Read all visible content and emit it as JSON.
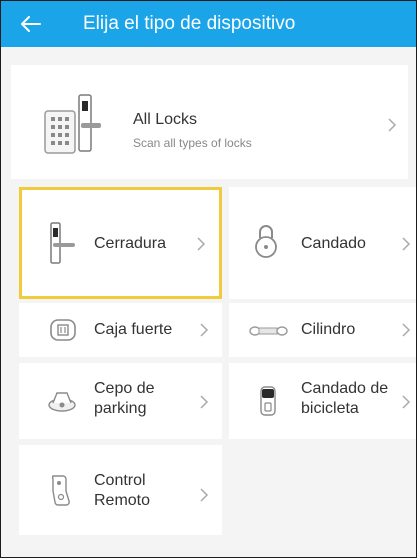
{
  "header": {
    "back_icon": "arrow-left-icon",
    "title": "Elija el tipo de dispositivo"
  },
  "all_locks": {
    "title": "All Locks",
    "subtitle": "Scan all types of locks",
    "icon": "keypad-lock-icon"
  },
  "devices": [
    {
      "label": "Cerradura",
      "icon": "door-lock-icon",
      "selected": true
    },
    {
      "label": "Candado",
      "icon": "padlock-icon",
      "selected": false
    },
    {
      "label": "Caja fuerte",
      "icon": "safe-icon",
      "selected": false
    },
    {
      "label": "Cilindro",
      "icon": "cylinder-icon",
      "selected": false
    },
    {
      "label": "Cepo de parking",
      "icon": "parking-lock-icon",
      "selected": false
    },
    {
      "label": "Candado de bicicleta",
      "icon": "bike-lock-icon",
      "selected": false
    },
    {
      "label": "Control Remoto",
      "icon": "remote-control-icon",
      "selected": false
    }
  ],
  "colors": {
    "appbar": "#1ba5e8",
    "selection_border": "#f1cb3b",
    "background": "#f4f4f4"
  }
}
